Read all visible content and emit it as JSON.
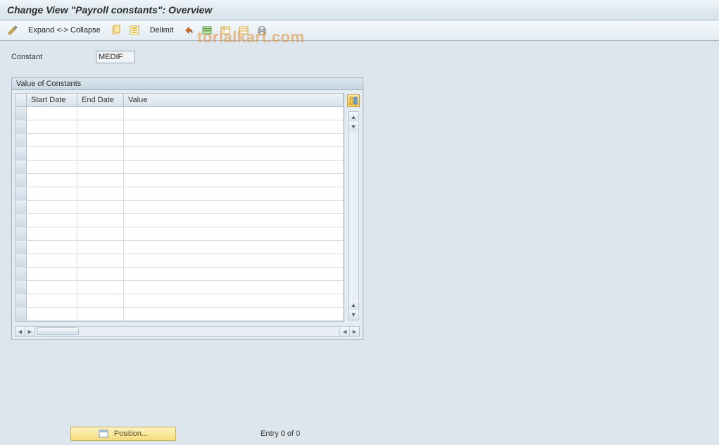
{
  "title": "Change View \"Payroll constants\": Overview",
  "toolbar": {
    "expand_collapse_label": "Expand <-> Collapse",
    "delimit_label": "Delimit"
  },
  "watermark": "torialkart.com",
  "constant": {
    "label": "Constant",
    "value": "MEDIF"
  },
  "panel": {
    "title": "Value of Constants",
    "columns": {
      "c1": "Start Date",
      "c2": "End Date",
      "c3": "Value"
    },
    "rows": [
      {
        "start": "",
        "end": "",
        "value": ""
      },
      {
        "start": "",
        "end": "",
        "value": ""
      },
      {
        "start": "",
        "end": "",
        "value": ""
      },
      {
        "start": "",
        "end": "",
        "value": ""
      },
      {
        "start": "",
        "end": "",
        "value": ""
      },
      {
        "start": "",
        "end": "",
        "value": ""
      },
      {
        "start": "",
        "end": "",
        "value": ""
      },
      {
        "start": "",
        "end": "",
        "value": ""
      },
      {
        "start": "",
        "end": "",
        "value": ""
      },
      {
        "start": "",
        "end": "",
        "value": ""
      },
      {
        "start": "",
        "end": "",
        "value": ""
      },
      {
        "start": "",
        "end": "",
        "value": ""
      },
      {
        "start": "",
        "end": "",
        "value": ""
      },
      {
        "start": "",
        "end": "",
        "value": ""
      },
      {
        "start": "",
        "end": "",
        "value": ""
      },
      {
        "start": "",
        "end": "",
        "value": ""
      }
    ]
  },
  "footer": {
    "position_label": "Position...",
    "entry_text": "Entry 0 of 0"
  }
}
